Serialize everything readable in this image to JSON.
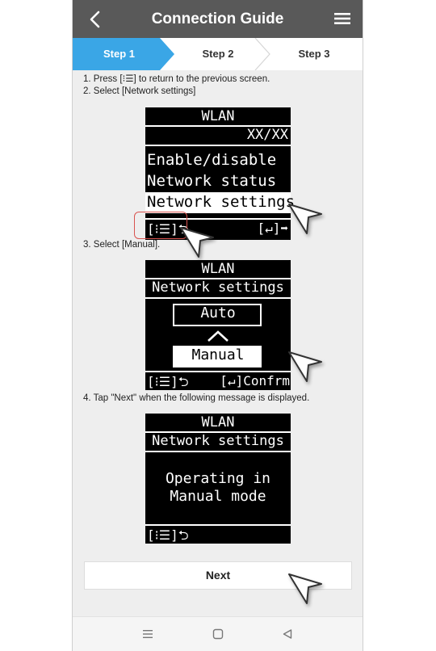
{
  "header": {
    "title": "Connection Guide",
    "back_icon": "chevron-left-icon",
    "menu_icon": "hamburger-menu-icon",
    "background": "#595959"
  },
  "steps": [
    {
      "label": "Step 1",
      "active": true
    },
    {
      "label": "Step 2",
      "active": false
    },
    {
      "label": "Step 3",
      "active": false
    }
  ],
  "step_active_color": "#3aa6e6",
  "instructions": {
    "line1": "1. Press [⁝☰] to return to the previous screen.",
    "line2": "2. Select [Network settings]",
    "line3": "3. Select [Manual].",
    "line4": "4. Tap \"Next\" when the following message is displayed."
  },
  "screen1": {
    "title": "WLAN",
    "value": "XX/XX",
    "items": [
      "Enable/disable",
      "Network status",
      "Network settings"
    ],
    "selected_index": 2,
    "footer_left": "[⁝☰]⮌",
    "footer_right": "[↵]➡"
  },
  "screen2": {
    "title": "WLAN",
    "subtitle": "Network settings",
    "option_top": "Auto",
    "option_selected": "Manual",
    "footer_left": "[⁝☰]⮌",
    "footer_right": "[↵]Confrm"
  },
  "screen3": {
    "title": "WLAN",
    "subtitle": "Network settings",
    "message_line1": "Operating in",
    "message_line2": "Manual mode",
    "footer_left": "[⁝☰]⮌"
  },
  "next_button": {
    "label": "Next"
  },
  "android_nav": {
    "icons": [
      "recent-apps-icon",
      "home-icon",
      "back-icon"
    ]
  }
}
